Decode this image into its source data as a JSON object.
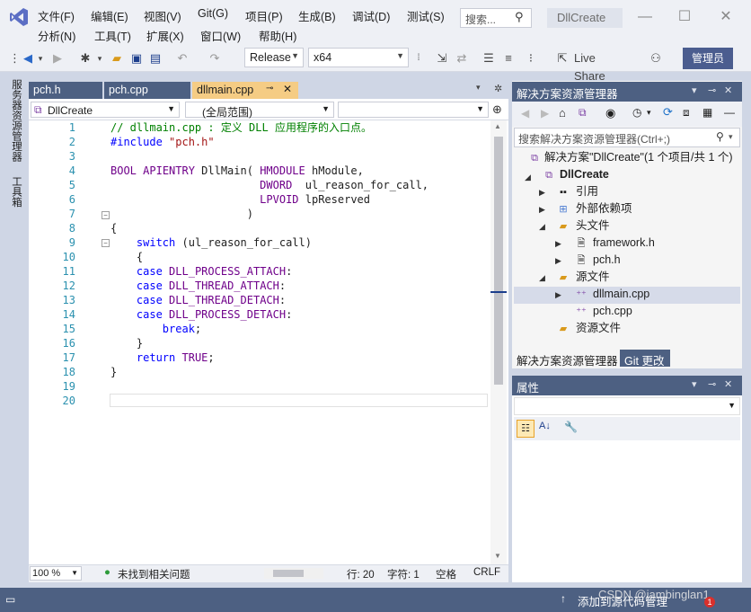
{
  "menu": {
    "items_row1": [
      "文件(F)",
      "编辑(E)",
      "视图(V)",
      "Git(G)",
      "项目(P)",
      "生成(B)",
      "调试(D)",
      "测试(S)"
    ],
    "items_row2": [
      "分析(N)",
      "工具(T)",
      "扩展(X)",
      "窗口(W)",
      "帮助(H)"
    ],
    "search_placeholder": "搜索...",
    "app_title": "DllCreate"
  },
  "toolbar": {
    "config": "Release",
    "platform": "x64",
    "live_share": "Live Share",
    "admin_button": "管理员"
  },
  "side_tabs": [
    "服务器资源管理器",
    "工具箱"
  ],
  "doc_tabs": [
    {
      "label": "pch.h",
      "active": false
    },
    {
      "label": "pch.cpp",
      "active": false
    },
    {
      "label": "dllmain.cpp",
      "active": true
    }
  ],
  "navbar": {
    "project": "DllCreate",
    "scope": "(全局范围)",
    "member": ""
  },
  "code_lines": [
    "// dllmain.cpp : 定义 DLL 应用程序的入口点。",
    "#include \"pch.h\"",
    "",
    "BOOL APIENTRY DllMain( HMODULE hModule,",
    "                       DWORD  ul_reason_for_call,",
    "                       LPVOID lpReserved",
    "                     )",
    "{",
    "    switch (ul_reason_for_call)",
    "    {",
    "    case DLL_PROCESS_ATTACH:",
    "    case DLL_THREAD_ATTACH:",
    "    case DLL_THREAD_DETACH:",
    "    case DLL_PROCESS_DETACH:",
    "        break;",
    "    }",
    "    return TRUE;",
    "}",
    "",
    ""
  ],
  "line_numbers": [
    "1",
    "2",
    "3",
    "4",
    "5",
    "6",
    "7",
    "8",
    "9",
    "10",
    "11",
    "12",
    "13",
    "14",
    "15",
    "16",
    "17",
    "18",
    "19",
    "20"
  ],
  "editor_status": {
    "zoom": "100 %",
    "issues": "未找到相关问题",
    "line": "行: 20",
    "char": "字符: 1",
    "spacing": "空格",
    "eol": "CRLF"
  },
  "solution_explorer": {
    "title": "解决方案资源管理器",
    "search_placeholder": "搜索解决方案资源管理器(Ctrl+;)",
    "tree": [
      {
        "label": "解决方案\"DllCreate\"(1 个项目/共 1 个)",
        "level": 0
      },
      {
        "label": "DllCreate",
        "level": 1
      },
      {
        "label": "引用",
        "level": 2
      },
      {
        "label": "外部依赖项",
        "level": 2
      },
      {
        "label": "头文件",
        "level": 2
      },
      {
        "label": "framework.h",
        "level": 3
      },
      {
        "label": "pch.h",
        "level": 3
      },
      {
        "label": "源文件",
        "level": 2
      },
      {
        "label": "dllmain.cpp",
        "level": 3
      },
      {
        "label": "pch.cpp",
        "level": 3
      },
      {
        "label": "资源文件",
        "level": 2
      }
    ],
    "bottom_tabs": [
      "解决方案资源管理器",
      "Git 更改"
    ]
  },
  "properties": {
    "title": "属性"
  },
  "statusbar": {
    "source_control": "添加到源代码管理",
    "watermark": "CSDN @jambinglan1"
  }
}
